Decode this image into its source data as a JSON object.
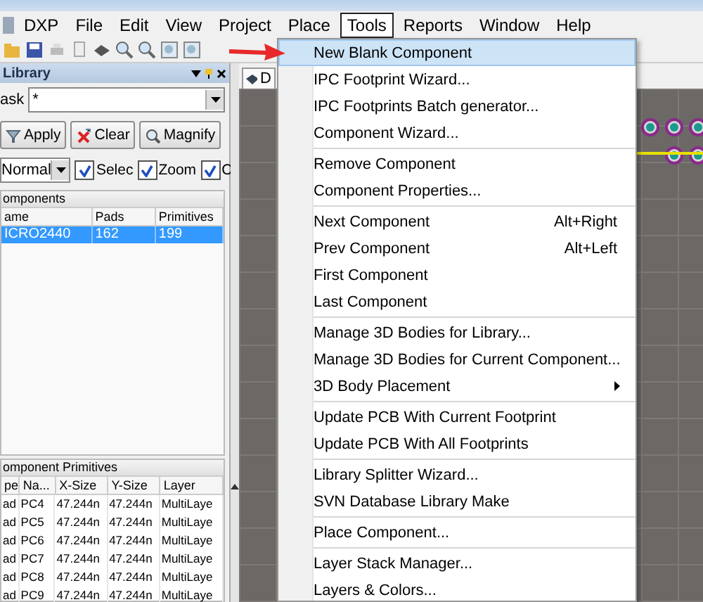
{
  "menu_bar": [
    {
      "label": "DXP",
      "selected": false
    },
    {
      "label": "File",
      "selected": false
    },
    {
      "label": "Edit",
      "selected": false
    },
    {
      "label": "View",
      "selected": false
    },
    {
      "label": "Project",
      "selected": false
    },
    {
      "label": "Place",
      "selected": false
    },
    {
      "label": "Tools",
      "selected": true
    },
    {
      "label": "Reports",
      "selected": false
    },
    {
      "label": "Window",
      "selected": false
    },
    {
      "label": "Help",
      "selected": false
    }
  ],
  "library_panel": {
    "title": "Library",
    "mask_label": "ask",
    "mask_value": "*",
    "buttons": [
      "Apply",
      "Clear",
      "Magnify"
    ],
    "mode": "Normal",
    "options": [
      {
        "label": "Selec",
        "checked": true
      },
      {
        "label": "Zoom",
        "checked": true
      },
      {
        "label": "C",
        "checked": true
      }
    ],
    "components": {
      "title": "omponents",
      "columns": [
        "ame",
        "Pads",
        "Primitives"
      ],
      "rows": [
        {
          "cells": [
            "ICRO2440",
            "162",
            "199"
          ],
          "selected": true
        }
      ]
    },
    "primitives": {
      "title": "omponent Primitives",
      "columns": [
        "pe",
        "Na...",
        "X-Size",
        "Y-Size",
        "Layer"
      ],
      "rows": [
        [
          "ad",
          "PC4",
          "47.244n",
          "47.244n",
          "MultiLaye"
        ],
        [
          "ad",
          "PC5",
          "47.244n",
          "47.244n",
          "MultiLaye"
        ],
        [
          "ad",
          "PC6",
          "47.244n",
          "47.244n",
          "MultiLaye"
        ],
        [
          "ad",
          "PC7",
          "47.244n",
          "47.244n",
          "MultiLaye"
        ],
        [
          "ad",
          "PC8",
          "47.244n",
          "47.244n",
          "MultiLaye"
        ],
        [
          "ad",
          "PC9",
          "47.244n",
          "47.244n",
          "MultiLaye"
        ]
      ]
    }
  },
  "document_tab": {
    "label": "D"
  },
  "tools_menu": [
    {
      "kind": "item",
      "label": "New Blank Component",
      "selected": true
    },
    {
      "kind": "item",
      "label": "IPC Footprint Wizard...",
      "selected": false
    },
    {
      "kind": "item",
      "label": "IPC Footprints Batch generator...",
      "selected": false
    },
    {
      "kind": "item",
      "label": "Component Wizard...",
      "selected": false
    },
    {
      "kind": "separator"
    },
    {
      "kind": "item",
      "label": "Remove Component",
      "selected": false
    },
    {
      "kind": "item",
      "label": "Component Properties...",
      "selected": false
    },
    {
      "kind": "separator"
    },
    {
      "kind": "item",
      "label": "Next Component",
      "shortcut": "Alt+Right",
      "selected": false
    },
    {
      "kind": "item",
      "label": "Prev Component",
      "shortcut": "Alt+Left",
      "selected": false
    },
    {
      "kind": "item",
      "label": "First Component",
      "selected": false
    },
    {
      "kind": "item",
      "label": "Last Component",
      "selected": false
    },
    {
      "kind": "separator"
    },
    {
      "kind": "item",
      "label": "Manage 3D Bodies for Library...",
      "selected": false
    },
    {
      "kind": "item",
      "label": "Manage 3D Bodies for Current Component...",
      "selected": false
    },
    {
      "kind": "submenu",
      "label": "3D Body Placement",
      "selected": false
    },
    {
      "kind": "separator"
    },
    {
      "kind": "item",
      "label": "Update PCB With Current Footprint",
      "selected": false
    },
    {
      "kind": "item",
      "label": "Update PCB With All Footprints",
      "selected": false
    },
    {
      "kind": "separator"
    },
    {
      "kind": "item",
      "label": "Library Splitter Wizard...",
      "selected": false
    },
    {
      "kind": "item",
      "label": "SVN Database Library Make",
      "selected": false
    },
    {
      "kind": "separator"
    },
    {
      "kind": "item",
      "label": "Place Component...",
      "selected": false
    },
    {
      "kind": "separator"
    },
    {
      "kind": "item",
      "label": "Layer Stack Manager...",
      "selected": false
    },
    {
      "kind": "item",
      "label": "Layers & Colors...",
      "selected": false
    }
  ]
}
